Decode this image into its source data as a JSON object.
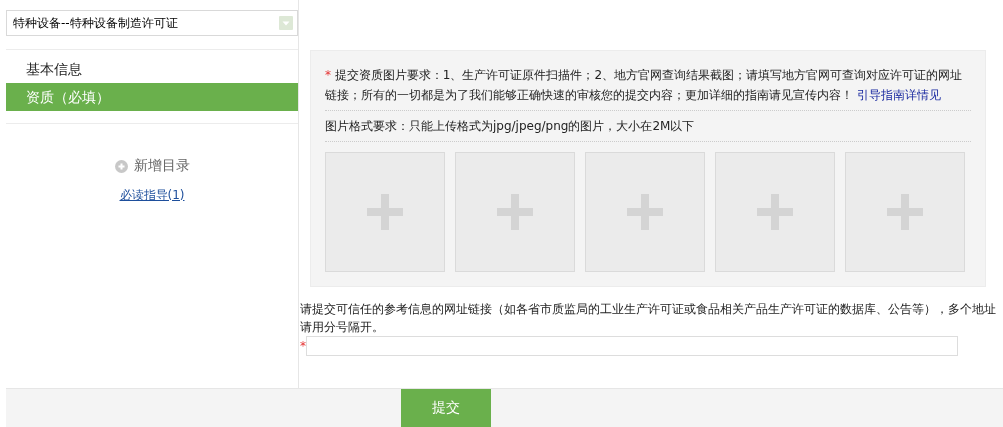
{
  "category_select": {
    "value": "特种设备--特种设备制造许可证"
  },
  "sidebar": {
    "items": [
      {
        "label": "基本信息",
        "selected": false
      },
      {
        "label": "资质（必填）",
        "selected": true
      }
    ],
    "add_directory": "新增目录",
    "guide_link": "必读指导(1)"
  },
  "notice": {
    "required_mark": "*",
    "text": "提交资质图片要求：1、生产许可证原件扫描件；2、地方官网查询结果截图；请填写地方官网可查询对应许可证的网址链接；所有的一切都是为了我们能够正确快速的审核您的提交内容；更加详细的指南请见宣传内容！",
    "link": "引导指南详情见"
  },
  "format_note": "图片格式要求：只能上传格式为jpg/jpeg/png的图片，大小在2M以下",
  "upload_slots": [
    {
      "kind": "add"
    },
    {
      "kind": "add"
    },
    {
      "kind": "add"
    },
    {
      "kind": "add"
    },
    {
      "kind": "add"
    }
  ],
  "url_field": {
    "label": "请提交可信任的参考信息的网址链接（如各省市质监局的工业生产许可证或食品相关产品生产许可证的数据库、公告等），多个地址请用分号隔开。",
    "required_mark": "*"
  },
  "submit_button": "提交"
}
